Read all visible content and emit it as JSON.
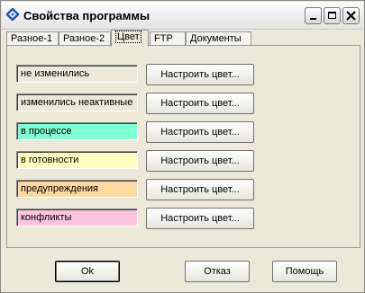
{
  "window": {
    "title": "Свойства программы"
  },
  "tabs": [
    {
      "label": "Разное-1",
      "active": false
    },
    {
      "label": "Разное-2",
      "active": false
    },
    {
      "label": "Цвет",
      "active": true
    },
    {
      "label": "FTP",
      "active": false
    },
    {
      "label": "Документы",
      "active": false
    }
  ],
  "color_rows": [
    {
      "label": "не изменились",
      "color": "#ffffff",
      "button": "Настроить цвет..."
    },
    {
      "label": "изменились неактивные",
      "color": "#ffffff",
      "button": "Настроить цвет..."
    },
    {
      "label": "в процессе",
      "color": "#7fffd4",
      "button": "Настроить цвет..."
    },
    {
      "label": "в готовности",
      "color": "#ffffc0",
      "button": "Настроить цвет..."
    },
    {
      "label": "предупреждения",
      "color": "#ffd9a0",
      "button": "Настроить цвет..."
    },
    {
      "label": "конфликты",
      "color": "#ffc4dc",
      "button": "Настроить цвет..."
    }
  ],
  "buttons": {
    "ok": "Ok",
    "cancel": "Отказ",
    "help": "Помощь"
  }
}
